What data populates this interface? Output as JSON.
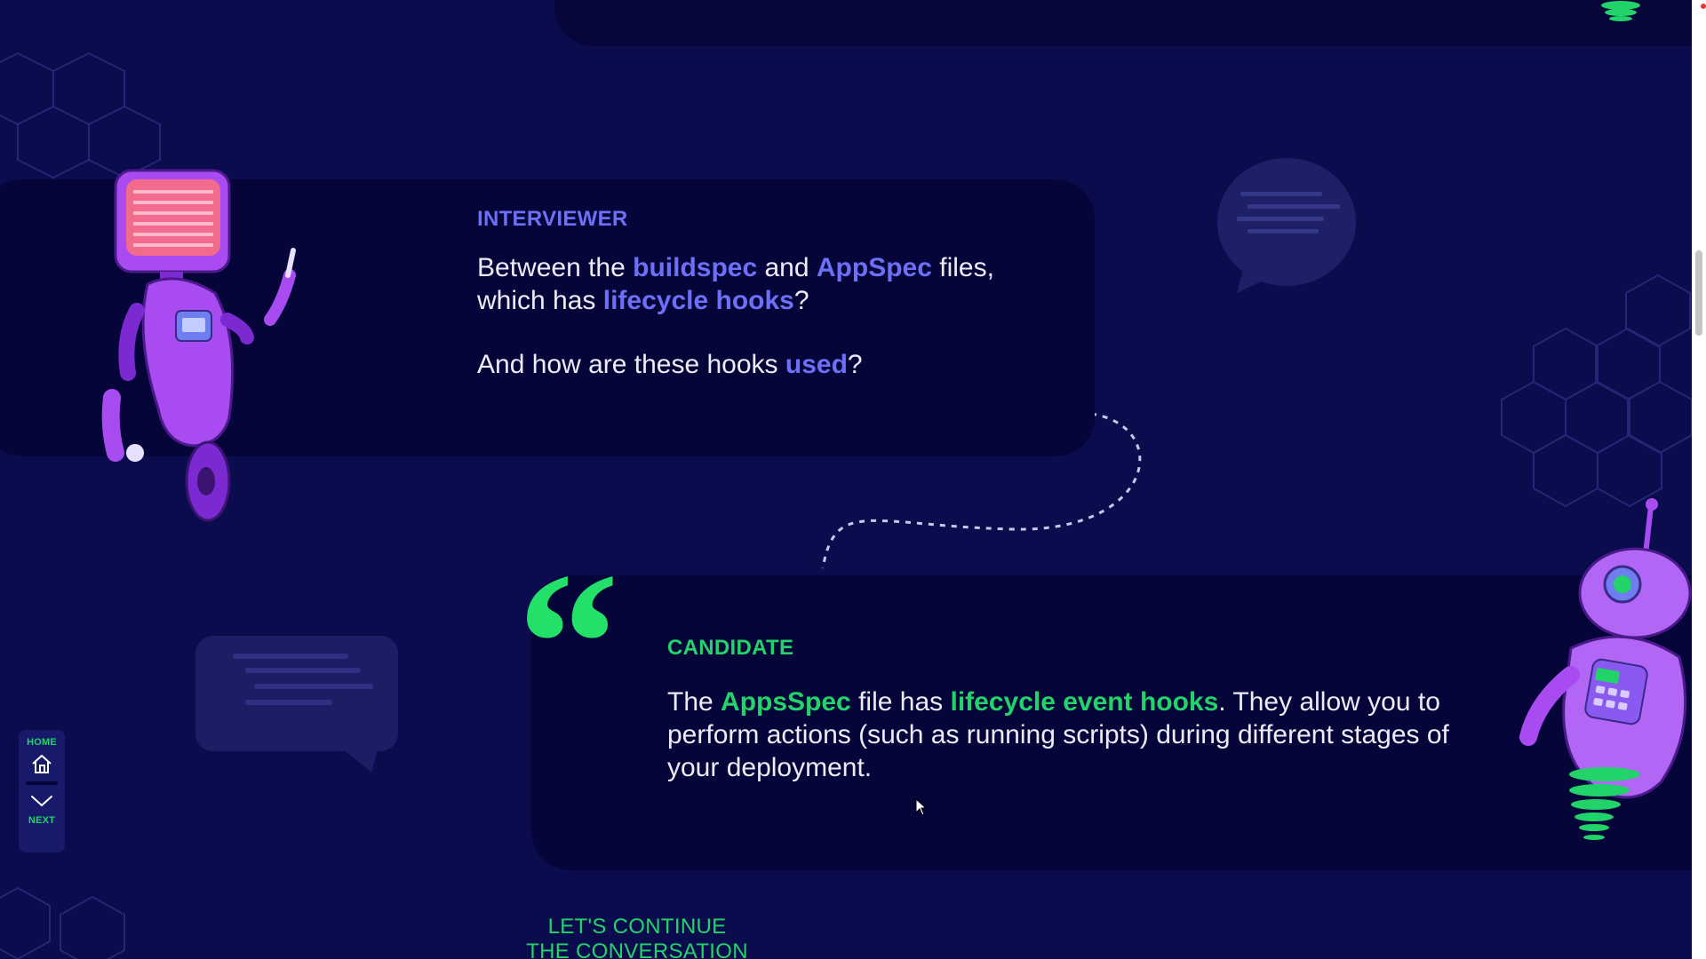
{
  "interviewer": {
    "label": "INTERVIEWER",
    "line1_parts": [
      "Between the ",
      "buildspec",
      " and ",
      "AppSpec",
      " files,"
    ],
    "line2_parts": [
      "which has ",
      "lifecycle hooks",
      "?"
    ],
    "line3_parts": [
      "And how are these hooks ",
      "used",
      "?"
    ]
  },
  "candidate": {
    "label": "CANDIDATE",
    "parts": [
      "The ",
      "AppsSpec",
      " file has ",
      "lifecycle event hooks",
      ". They allow you to perform actions (such as running scripts) during different stages of your deployment."
    ]
  },
  "quote_glyph": "“",
  "nav": {
    "home_label": "HOME",
    "next_label": "NEXT",
    "home_icon": "home-icon",
    "next_icon": "chevron-down-icon"
  },
  "continue": {
    "line1": "LET'S CONTINUE",
    "line2": "THE CONVERSATION"
  },
  "colors": {
    "background": "#0b0c4e",
    "card": "#06053a",
    "accent_blue": "#6b70f6",
    "accent_green": "#22d36a"
  }
}
